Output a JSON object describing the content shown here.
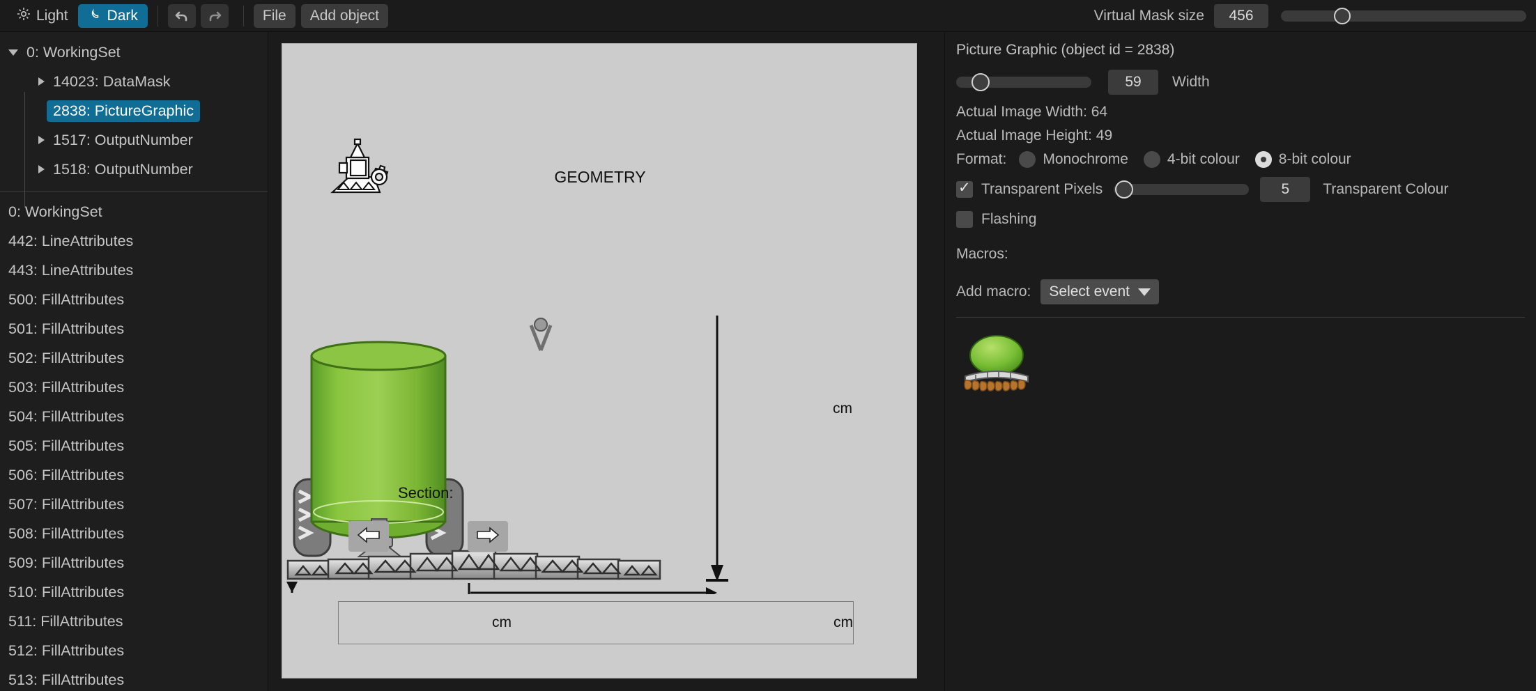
{
  "toolbar": {
    "light_label": "Light",
    "dark_label": "Dark",
    "light_icon": "sun-icon",
    "dark_icon": "moon-icon",
    "undo_icon": "undo-arrow-icon",
    "redo_icon": "redo-arrow-icon",
    "file_label": "File",
    "add_object_label": "Add object",
    "mask_size_label": "Virtual Mask size",
    "mask_size_value": "456"
  },
  "sidebar": {
    "tree": [
      {
        "label": "0: WorkingSet",
        "depth": 0,
        "arrow": "down",
        "selected": false
      },
      {
        "label": "14023: DataMask",
        "depth": 1,
        "arrow": "right",
        "selected": false
      },
      {
        "label": "2838: PictureGraphic",
        "depth": 1,
        "arrow": "none",
        "selected": true
      },
      {
        "label": "1517: OutputNumber",
        "depth": 1,
        "arrow": "right",
        "selected": false
      },
      {
        "label": "1518: OutputNumber",
        "depth": 1,
        "arrow": "right",
        "selected": false
      }
    ],
    "flat_list": [
      "0: WorkingSet",
      "442: LineAttributes",
      "443: LineAttributes",
      "500: FillAttributes",
      "501: FillAttributes",
      "502: FillAttributes",
      "503: FillAttributes",
      "504: FillAttributes",
      "505: FillAttributes",
      "506: FillAttributes",
      "507: FillAttributes",
      "508: FillAttributes",
      "509: FillAttributes",
      "510: FillAttributes",
      "511: FillAttributes",
      "512: FillAttributes",
      "513: FillAttributes"
    ]
  },
  "canvas": {
    "title": "GEOMETRY",
    "geometry_icon": "terminal-gear-icon",
    "section_label": "Section:",
    "left_arrow_icon": "arrow-left-icon",
    "right_arrow_icon": "arrow-right-icon",
    "height_unit": "cm",
    "width_unit_left": "cm",
    "width_unit_right": "cm",
    "sprayer_icon": "sprayer-tank-boom-illustration"
  },
  "properties": {
    "title": "Picture Graphic (object id = 2838)",
    "width_value": "59",
    "width_label": "Width",
    "actual_image_width": "Actual Image Width: 64",
    "actual_image_height": "Actual Image Height: 49",
    "format_label": "Format:",
    "format_options": [
      {
        "label": "Monochrome",
        "selected": false
      },
      {
        "label": "4-bit colour",
        "selected": false
      },
      {
        "label": "8-bit colour",
        "selected": true
      }
    ],
    "transparent_pixels_label": "Transparent Pixels",
    "transparent_pixels_checked": true,
    "transparent_colour_value": "5",
    "transparent_colour_label": "Transparent Colour",
    "flashing_label": "Flashing",
    "flashing_checked": false,
    "macros_label": "Macros:",
    "add_macro_label": "Add macro:",
    "select_event_label": "Select event",
    "preview_icon": "picture-graphic-preview"
  },
  "colors": {
    "accent": "#0f6d96",
    "panel_bg": "#1b1b1b",
    "sidebar_bg": "#1e1e1e",
    "screen_bg": "#cccccc"
  }
}
